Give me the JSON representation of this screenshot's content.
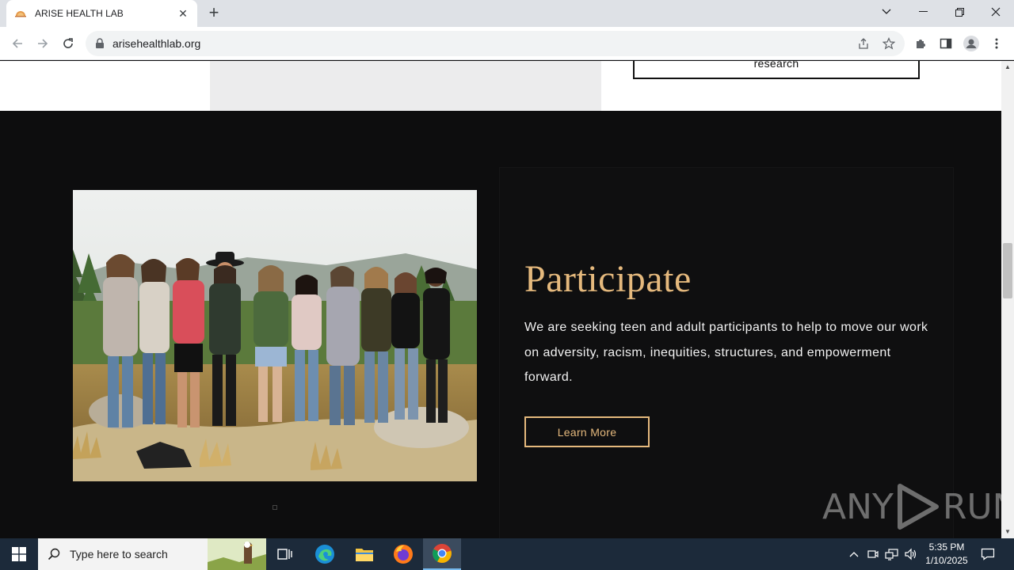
{
  "browser": {
    "tab_title": "ARISE HEALTH LAB",
    "url": "arisehealthlab.org"
  },
  "page": {
    "research_button_label": "research",
    "participate": {
      "heading": "Participate",
      "paragraph": "We are seeking teen and adult participants to help to move our work on adversity, racism, inequities, structures, and empowerment forward.",
      "button_label": "Learn More"
    },
    "colors": {
      "accent": "#e5b97d",
      "background": "#0d0d0e"
    }
  },
  "watermark": {
    "left_text": "ANY",
    "right_text": "RUN"
  },
  "taskbar": {
    "search_placeholder": "Type here to search",
    "time": "5:35 PM",
    "date": "1/10/2025",
    "apps": [
      "task-view-icon",
      "edge-icon",
      "file-explorer-icon",
      "firefox-icon",
      "chrome-icon"
    ]
  }
}
